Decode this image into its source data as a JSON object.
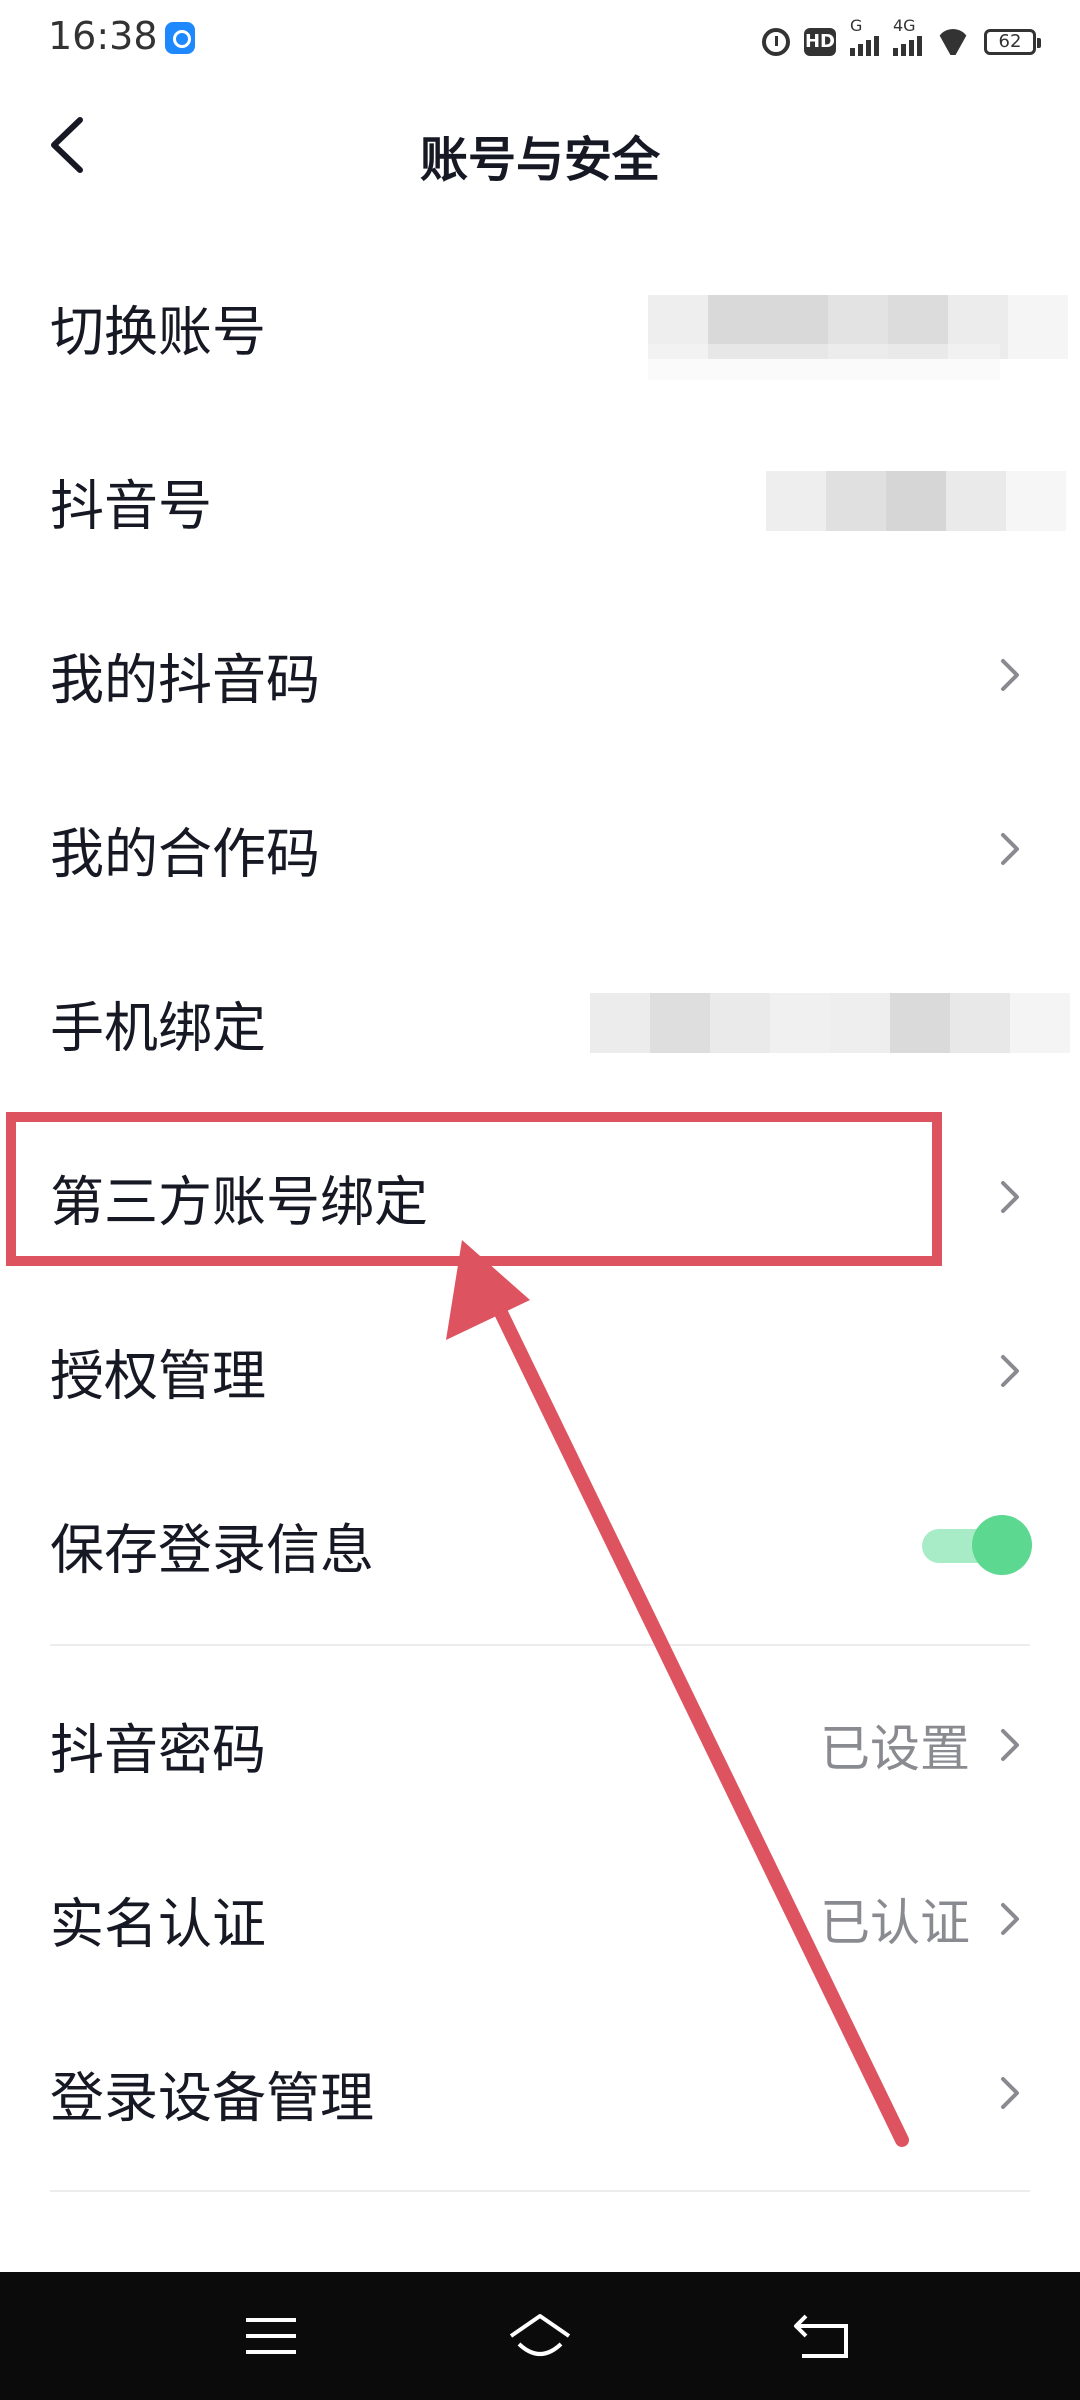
{
  "status_bar": {
    "time": "16:38",
    "network_label": "4G",
    "signal_label": "G",
    "hd_label": "HD",
    "battery": "62"
  },
  "header": {
    "title": "账号与安全"
  },
  "rows": [
    {
      "label": "切换账号"
    },
    {
      "label": "抖音号"
    },
    {
      "label": "我的抖音码"
    },
    {
      "label": "我的合作码"
    },
    {
      "label": "手机绑定"
    },
    {
      "label": "第三方账号绑定"
    },
    {
      "label": "授权管理"
    },
    {
      "label": "保存登录信息",
      "toggle_on": true
    },
    {
      "label": "抖音密码",
      "value": "已设置"
    },
    {
      "label": "实名认证",
      "value": "已认证"
    },
    {
      "label": "登录设备管理"
    }
  ],
  "colors": {
    "highlight": "#de5360",
    "toggle_track": "#a8ecc7",
    "toggle_knob": "#5cd890"
  }
}
